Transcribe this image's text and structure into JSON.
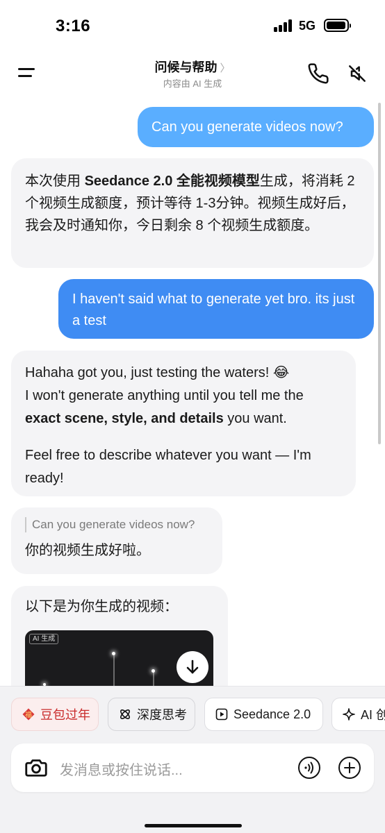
{
  "status_bar": {
    "time": "3:16",
    "network": "5G"
  },
  "header": {
    "title": "问候与帮助",
    "subtitle": "内容由 AI 生成"
  },
  "messages": {
    "user_1": "Can you generate videos now?",
    "ai_1": {
      "before": "本次使用 ",
      "bold": "Seedance 2.0 全能视频模型",
      "after": "生成，将消耗 2 个视频生成额度，预计等待 1-3分钟。视频生成好后，我会及时通知你，今日剩余 8 个视频生成额度。"
    },
    "user_2": "I haven't said what to generate yet bro. its just a test",
    "ai_2": {
      "line1": "Hahaha got you, just testing the waters! 😂",
      "line2_before": "I won't generate anything until you tell me the ",
      "line2_bold": "exact scene, style, and details",
      "line2_after": " you want.",
      "para2": "Feel free to describe whatever you want — I'm ready!"
    },
    "ai_3": {
      "quote": "Can you generate videos now?",
      "reply": "你的视频生成好啦。"
    },
    "ai_4": {
      "intro": "以下是为你生成的视频：",
      "video_badge": "AI 生成"
    }
  },
  "quick_chips": [
    "豆包过年",
    "深度思考",
    "Seedance 2.0",
    "AI 创"
  ],
  "input": {
    "placeholder": "发消息或按住说话..."
  },
  "colors": {
    "user_bubble_light": "#5aaeff",
    "user_bubble": "#3f8cf3",
    "ai_bubble": "#f4f4f6",
    "new_year_red": "#c92b2b"
  },
  "icons": {
    "menu": "menu-icon",
    "phone": "phone-icon",
    "mute": "speaker-muted-icon",
    "download": "download-icon",
    "camera": "camera-icon",
    "voice": "voice-wave-icon",
    "plus": "plus-circle-icon",
    "think": "atom-icon",
    "seedance": "play-square-icon",
    "ai_create": "sparkle-icon",
    "new_year": "fu-icon"
  }
}
